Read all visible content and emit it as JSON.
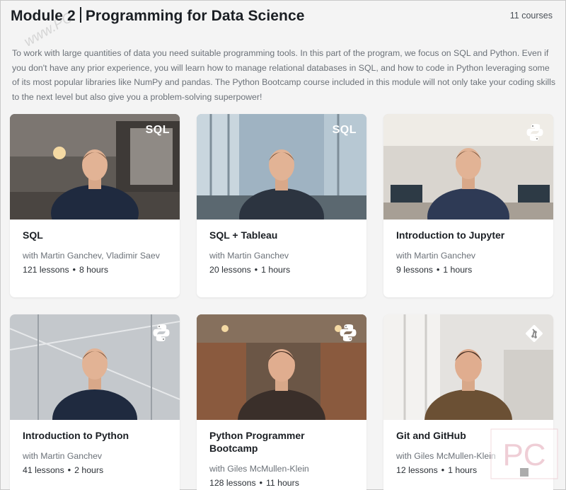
{
  "module": {
    "title_prefix": "Module 2",
    "title_main": "Programming for Data Science",
    "course_count": "11 courses",
    "description": "To work with large quantities of data you need suitable programming tools. In this part of the program, we focus on SQL and Python. Even if you don't have any prior experience, you will learn how to manage relational databases in SQL, and how to code in Python leveraging some of its most popular libraries like NumPy and pandas. The Python Bootcamp course included in this module will not only take your coding skills to the next level but also give you a problem-solving superpower!"
  },
  "courses": [
    {
      "name": "SQL",
      "instructors": "with Martin Ganchev, Vladimir Saev",
      "lessons": "121 lessons",
      "hours": "8 hours",
      "badge": "SQL",
      "icon": "sql-badge"
    },
    {
      "name": "SQL + Tableau",
      "instructors": "with Martin Ganchev",
      "lessons": "20 lessons",
      "hours": "1 hours",
      "badge": "SQL",
      "icon": "sql-badge"
    },
    {
      "name": "Introduction to Jupyter",
      "instructors": "with Martin Ganchev",
      "lessons": "9 lessons",
      "hours": "1 hours",
      "badge": "",
      "icon": "python-icon"
    },
    {
      "name": "Introduction to Python",
      "instructors": "with Martin Ganchev",
      "lessons": "41 lessons",
      "hours": "2 hours",
      "badge": "",
      "icon": "python-icon"
    },
    {
      "name": "Python Programmer Bootcamp",
      "instructors": "with Giles McMullen-Klein",
      "lessons": "128 lessons",
      "hours": "11 hours",
      "badge": "",
      "icon": "python-icon"
    },
    {
      "name": "Git and GitHub",
      "instructors": "with Giles McMullen-Klein",
      "lessons": "12 lessons",
      "hours": "1 hours",
      "badge": "",
      "icon": "git-icon"
    }
  ],
  "meta_separator": "•",
  "watermark_text": "www.PC",
  "logo_text": "PC"
}
